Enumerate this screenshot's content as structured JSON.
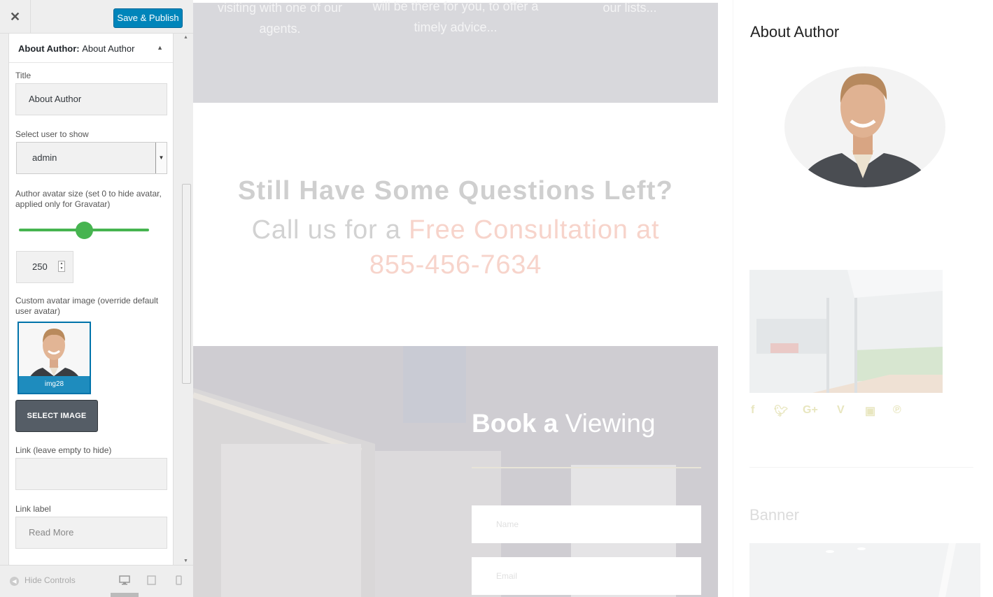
{
  "toolbar": {
    "close_label": "✕",
    "save_label": "Save & Publish"
  },
  "section": {
    "widget_type": "About Author:",
    "widget_name": "About Author",
    "collapse_icon": "triangle-up-icon"
  },
  "fields": {
    "title_label": "Title",
    "title_value": "About Author",
    "user_label": "Select user to show",
    "user_value": "admin",
    "avatar_size_label": "Author avatar size (set 0 to hide avatar, applied only for Gravatar)",
    "avatar_size_value": "250",
    "avatar_size_slider_fraction": 0.5,
    "custom_avatar_label": "Custom avatar image (override default user avatar)",
    "image_caption": "img28",
    "select_image_label": "SELECT IMAGE",
    "link_label": "Link (leave empty to hide)",
    "link_value": "",
    "link_label_label": "Link label",
    "link_label_placeholder": "Read More"
  },
  "footer": {
    "hide_controls": "Hide Controls"
  },
  "preview": {
    "band_texts": [
      "visiting with one of our agents.",
      "will be there for you, to offer a timely advice...",
      "our lists..."
    ],
    "question_heading": "Still Have Some Questions Left?",
    "question_sub_plain": "Call us for a ",
    "question_sub_highlight": "Free Consultation at 855-456-7634",
    "book_bold": "Book a",
    "book_light": " Viewing",
    "book_name_placeholder": "Name",
    "book_email_placeholder": "Email",
    "sidebar_title": "About Author",
    "banner_title": "Banner"
  },
  "colors": {
    "save_button": "#0085ba",
    "slider": "#46b450",
    "highlight": "#f7d4cb"
  }
}
